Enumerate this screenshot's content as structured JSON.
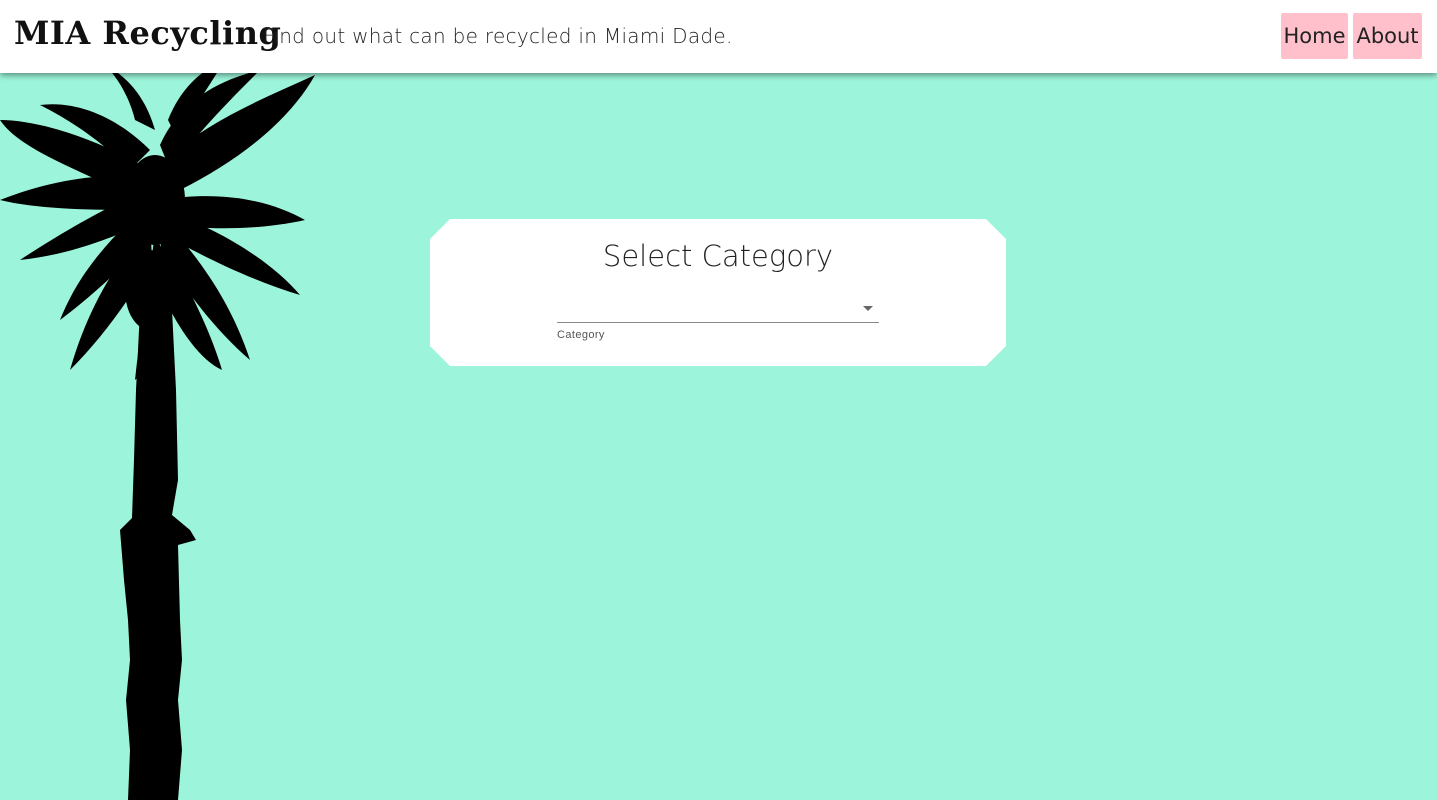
{
  "header": {
    "title": "MIA Recycling",
    "tagline": "Find out what can be recycled in Miami Dade.",
    "nav": [
      {
        "label": "Home"
      },
      {
        "label": "About"
      }
    ]
  },
  "card": {
    "title": "Select Category",
    "select": {
      "value": "",
      "helper_label": "Category"
    }
  },
  "colors": {
    "background": "#9cf5da",
    "nav_button": "#ffc0cb",
    "card": "#ffffff"
  },
  "icons": {
    "dropdown": "chevron-down-icon",
    "palm": "palm-tree-silhouette"
  }
}
